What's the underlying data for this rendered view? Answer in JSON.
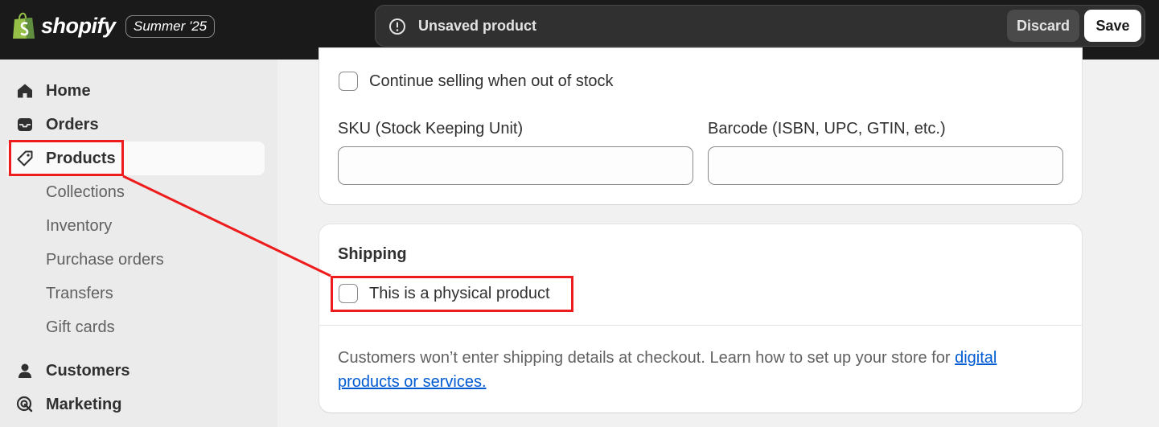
{
  "topbar": {
    "brand": "shopify",
    "edition": "Summer '25",
    "status": "Unsaved product",
    "discard_label": "Discard",
    "save_label": "Save"
  },
  "sidebar": {
    "items": [
      {
        "label": "Home",
        "icon": "home-icon"
      },
      {
        "label": "Orders",
        "icon": "inbox-icon"
      },
      {
        "label": "Products",
        "icon": "tag-icon",
        "active": true
      }
    ],
    "product_sub_items": [
      "Collections",
      "Inventory",
      "Purchase orders",
      "Transfers",
      "Gift cards"
    ],
    "items_after": [
      {
        "label": "Customers",
        "icon": "person-icon"
      },
      {
        "label": "Marketing",
        "icon": "target-icon"
      }
    ]
  },
  "inventory": {
    "continue_selling_label": "Continue selling when out of stock",
    "continue_selling_checked": false,
    "sku_label": "SKU (Stock Keeping Unit)",
    "sku_value": "",
    "barcode_label": "Barcode (ISBN, UPC, GTIN, etc.)",
    "barcode_value": ""
  },
  "shipping": {
    "title": "Shipping",
    "physical_label": "This is a physical product",
    "physical_checked": false,
    "help_text": "Customers won’t enter shipping details at checkout. Learn how to set up your store for ",
    "help_link": "digital products or services."
  },
  "colors": {
    "topbar_bg": "#1a1a1a",
    "annotation": "#ee1c1c",
    "link": "#005bd3"
  }
}
